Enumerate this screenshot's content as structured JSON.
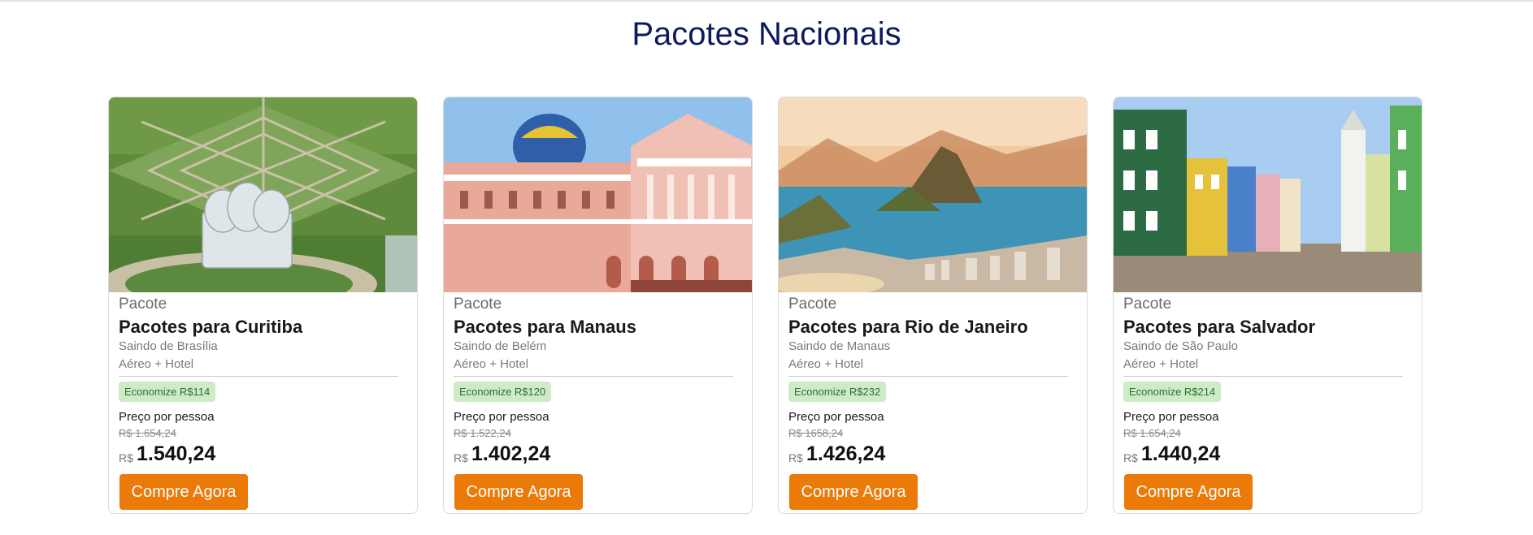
{
  "section": {
    "title": "Pacotes Nacionais"
  },
  "cards": [
    {
      "kicker": "Pacote",
      "title": "Pacotes para Curitiba",
      "origin": "Saindo de Brasília",
      "combo": "Aéreo + Hotel",
      "badge": "Economize R$114",
      "per_person": "Preço por pessoa",
      "old_price": "R$ 1.654,24",
      "currency": "R$",
      "price": "1.540,24",
      "button": "Compre Agora"
    },
    {
      "kicker": "Pacote",
      "title": "Pacotes para Manaus",
      "origin": "Saindo de Belém",
      "combo": "Aéreo + Hotel",
      "badge": "Economize R$120",
      "per_person": "Preço por pessoa",
      "old_price": "R$ 1.522,24",
      "currency": "R$",
      "price": "1.402,24",
      "button": "Compre Agora"
    },
    {
      "kicker": "Pacote",
      "title": "Pacotes para Rio de Janeiro",
      "origin": "Saindo de Manaus",
      "combo": "Aéreo + Hotel",
      "badge": "Economize R$232",
      "per_person": "Preço por pessoa",
      "old_price": "R$ 1658,24",
      "currency": "R$",
      "price": "1.426,24",
      "button": "Compre Agora"
    },
    {
      "kicker": "Pacote",
      "title": "Pacotes para Salvador",
      "origin": "Saindo de São Paulo",
      "combo": "Aéreo + Hotel",
      "badge": "Economize R$214",
      "per_person": "Preço por pessoa",
      "old_price": "R$ 1.654,24",
      "currency": "R$",
      "price": "1.440,24",
      "button": "Compre Agora"
    }
  ],
  "colors": {
    "title": "#0d1a5e",
    "button": "#ec7a08",
    "badge_bg": "#cdebc6",
    "badge_text": "#2f6f2f"
  }
}
